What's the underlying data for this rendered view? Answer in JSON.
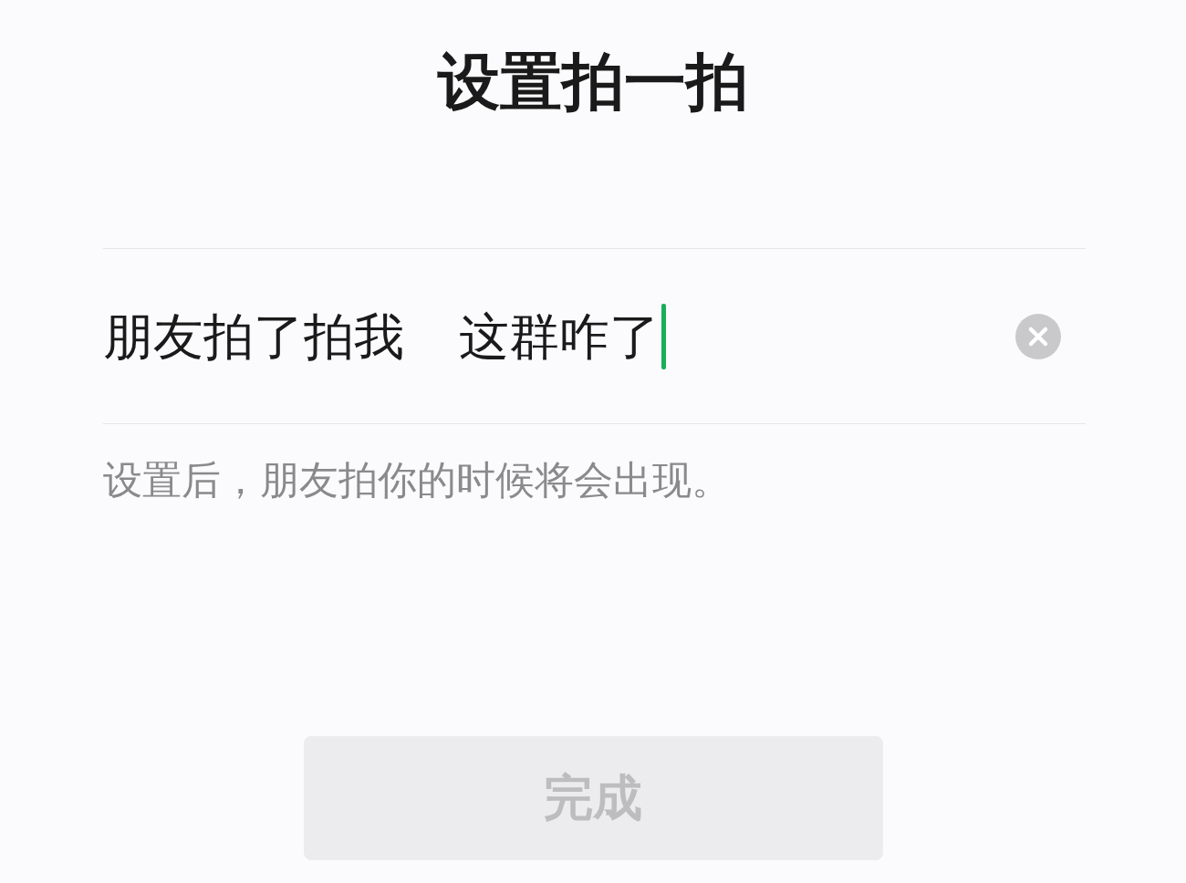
{
  "title": "设置拍一拍",
  "field": {
    "prefix": "朋友拍了拍我",
    "value": "这群咋了",
    "focused": true
  },
  "hint": "设置后，朋友拍你的时候将会出现。",
  "button": {
    "label": "完成",
    "disabled": true
  }
}
